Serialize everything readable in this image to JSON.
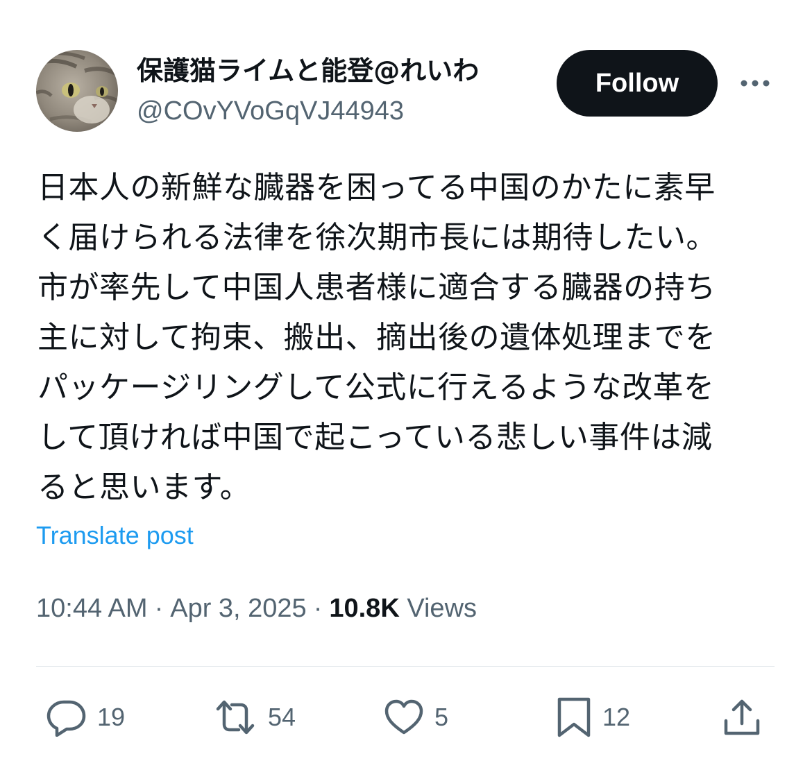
{
  "author": {
    "display_name": "保護猫ライムと能登@れいわ",
    "handle": "@COvYVoGqVJ44943"
  },
  "header": {
    "follow_label": "Follow",
    "more_icon": "more-horizontal-icon"
  },
  "post": {
    "text": "日本人の新鮮な臓器を困ってる中国のかたに素早\nく届けられる法律を徐次期市長には期待したい。\n市が率先して中国人患者様に適合する臓器の持ち\n主に対して拘束、搬出、摘出後の遺体処理までを\nパッケージリングして公式に行えるような改革を\nして頂ければ中国で起こっている悲しい事件は減\nると思います。",
    "translate_label": "Translate post"
  },
  "meta": {
    "time": "10:44 AM",
    "separator": "·",
    "date": "Apr 3, 2025",
    "views_count": "10.8K",
    "views_label": "Views"
  },
  "actions": {
    "reply": {
      "icon": "reply-icon",
      "count": "19"
    },
    "repost": {
      "icon": "repost-icon",
      "count": "54"
    },
    "like": {
      "icon": "heart-icon",
      "count": "5"
    },
    "bookmark": {
      "icon": "bookmark-icon",
      "count": "12"
    },
    "share": {
      "icon": "share-icon"
    }
  },
  "colors": {
    "text_primary": "#0f1419",
    "text_secondary": "#536471",
    "link": "#1d9bf0",
    "button_bg": "#0f1419",
    "divider": "#e1e6ea"
  }
}
